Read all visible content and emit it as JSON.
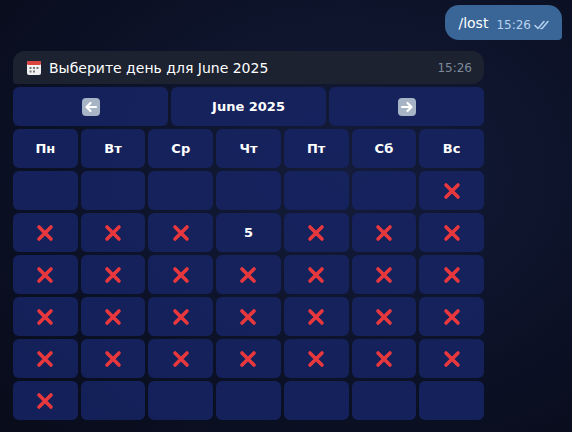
{
  "outgoing": {
    "text": "/lost",
    "time": "15:26",
    "read": true
  },
  "bot_message": {
    "text": "Выберите день для June 2025",
    "time": "15:26"
  },
  "keyboard": {
    "nav": [
      {
        "kind": "prev"
      },
      {
        "kind": "title",
        "text": "June 2025"
      },
      {
        "kind": "next"
      }
    ],
    "weekdays": [
      "Пн",
      "Вт",
      "Ср",
      "Чт",
      "Пт",
      "Сб",
      "Вс"
    ],
    "weeks": [
      [
        {
          "kind": "empty"
        },
        {
          "kind": "empty"
        },
        {
          "kind": "empty"
        },
        {
          "kind": "empty"
        },
        {
          "kind": "empty"
        },
        {
          "kind": "empty"
        },
        {
          "kind": "blocked"
        }
      ],
      [
        {
          "kind": "blocked"
        },
        {
          "kind": "blocked"
        },
        {
          "kind": "blocked"
        },
        {
          "kind": "day",
          "text": "5"
        },
        {
          "kind": "blocked"
        },
        {
          "kind": "blocked"
        },
        {
          "kind": "blocked"
        }
      ],
      [
        {
          "kind": "blocked"
        },
        {
          "kind": "blocked"
        },
        {
          "kind": "blocked"
        },
        {
          "kind": "blocked"
        },
        {
          "kind": "blocked"
        },
        {
          "kind": "blocked"
        },
        {
          "kind": "blocked"
        }
      ],
      [
        {
          "kind": "blocked"
        },
        {
          "kind": "blocked"
        },
        {
          "kind": "blocked"
        },
        {
          "kind": "blocked"
        },
        {
          "kind": "blocked"
        },
        {
          "kind": "blocked"
        },
        {
          "kind": "blocked"
        }
      ],
      [
        {
          "kind": "blocked"
        },
        {
          "kind": "blocked"
        },
        {
          "kind": "blocked"
        },
        {
          "kind": "blocked"
        },
        {
          "kind": "blocked"
        },
        {
          "kind": "blocked"
        },
        {
          "kind": "blocked"
        }
      ],
      [
        {
          "kind": "blocked"
        },
        {
          "kind": "empty"
        },
        {
          "kind": "empty"
        },
        {
          "kind": "empty"
        },
        {
          "kind": "empty"
        },
        {
          "kind": "empty"
        },
        {
          "kind": "empty"
        }
      ]
    ]
  }
}
